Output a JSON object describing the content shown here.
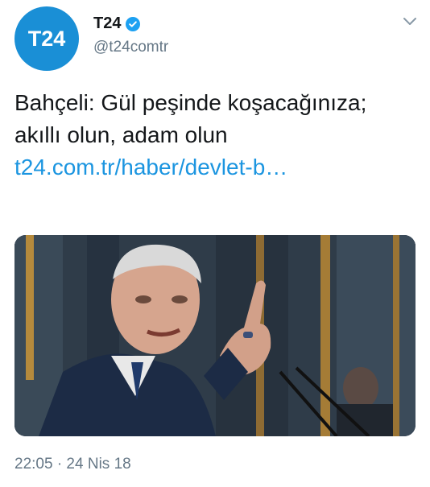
{
  "author": {
    "avatar_text": "T24",
    "display_name": "T24",
    "handle": "@t24comtr",
    "verified": true
  },
  "icons": {
    "verified": "verified-badge-icon",
    "menu": "chevron-down-icon"
  },
  "tweet": {
    "text": "Bahçeli: Gül peşinde koşacağınıza; akıllı olun, adam olun",
    "link": "t24.com.tr/haber/devlet-b…",
    "timestamp": "22:05 · 24 Nis 18"
  },
  "colors": {
    "brand": "#1a8fd6",
    "link": "#1b95e0",
    "secondary_text": "#657786"
  }
}
